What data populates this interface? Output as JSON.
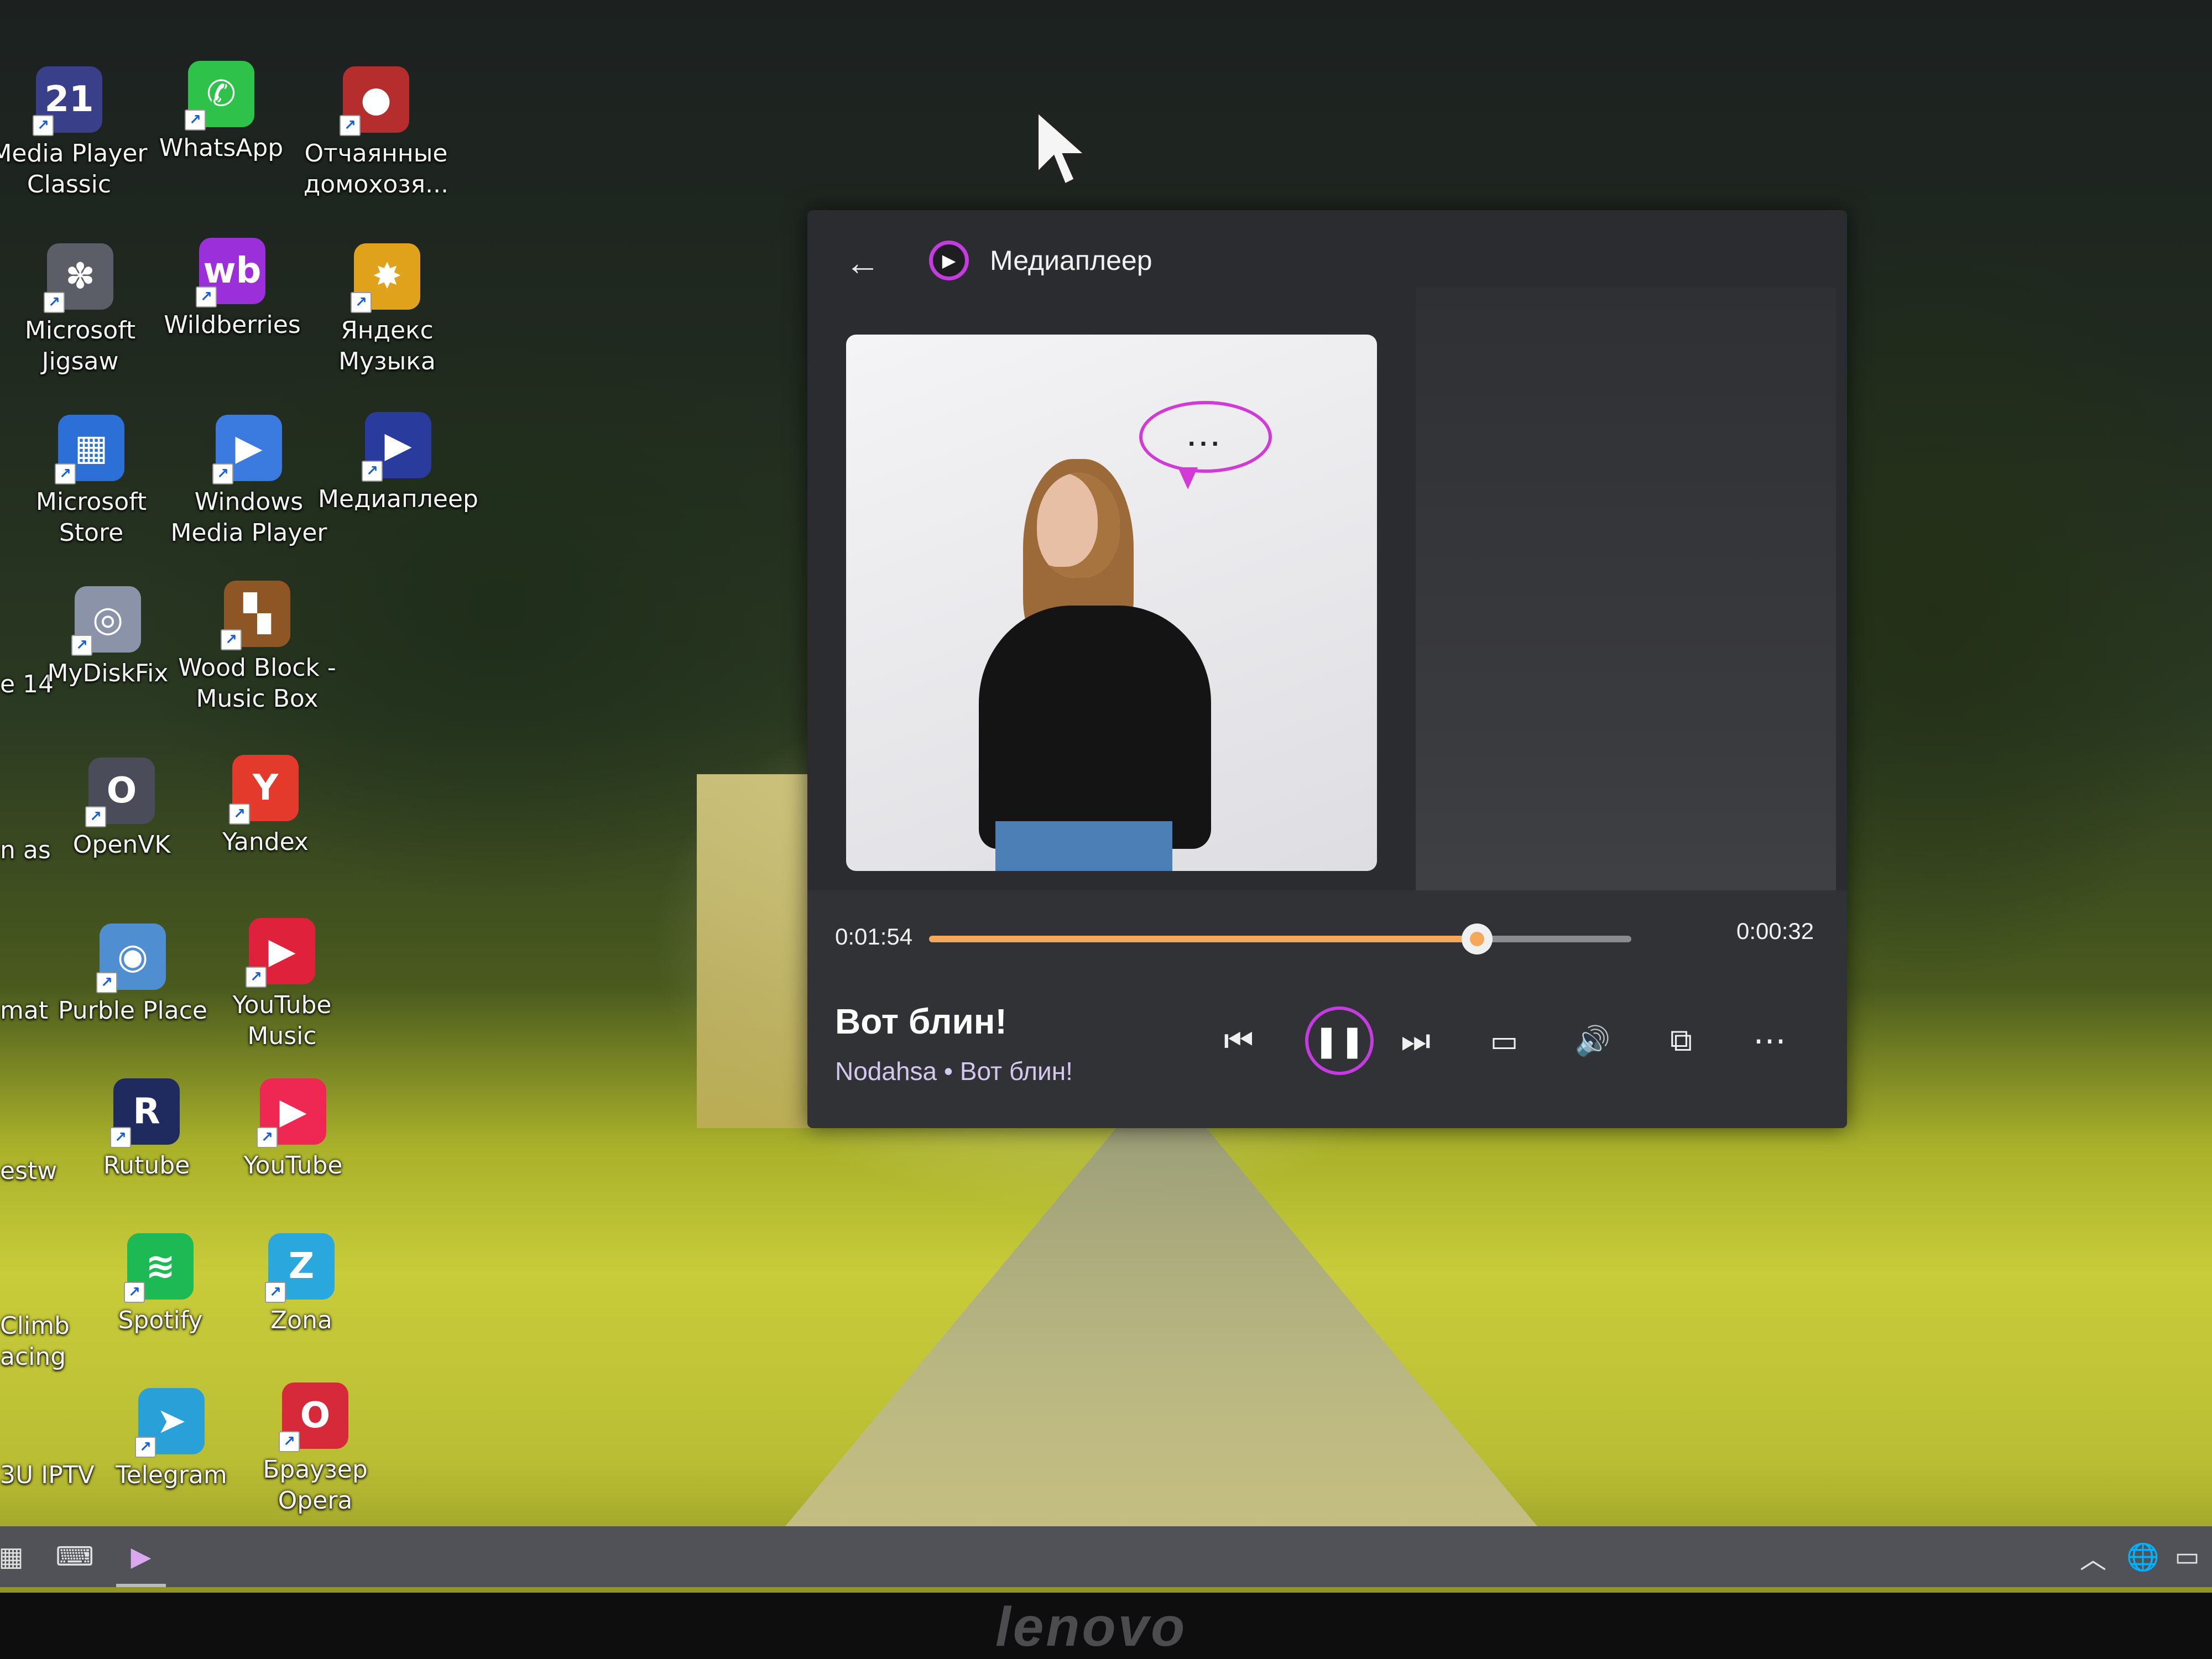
{
  "desktop": {
    "icons": [
      {
        "label": "Media Player Classic",
        "glyph": "21",
        "color": "#3a3f8a"
      },
      {
        "label": "WhatsApp",
        "glyph": "✆",
        "color": "#2ec24b"
      },
      {
        "label": "Отчаянные домохозя...",
        "glyph": "●",
        "color": "#b52d2d"
      },
      {
        "label": "Microsoft Jigsaw",
        "glyph": "✽",
        "color": "#5b5e66"
      },
      {
        "label": "Wildberries",
        "glyph": "wb",
        "color": "#9b2fd9"
      },
      {
        "label": "Яндекс Музыка",
        "glyph": "✸",
        "color": "#e0a21b"
      },
      {
        "label": "Microsoft Store",
        "glyph": "▦",
        "color": "#2c6fd6"
      },
      {
        "label": "Windows Media Player",
        "glyph": "▶",
        "color": "#3b7be0"
      },
      {
        "label": "Медиаплеер",
        "glyph": "▶",
        "color": "#2a3b9e"
      },
      {
        "label": "MyDiskFix",
        "glyph": "◎",
        "color": "#8a93a8"
      },
      {
        "label": "Wood Block - Music Box",
        "glyph": "▚",
        "color": "#8d5624"
      },
      {
        "label": "OpenVK",
        "glyph": "O",
        "color": "#4a4d59"
      },
      {
        "label": "Yandex",
        "glyph": "Y",
        "color": "#e33a2b"
      },
      {
        "label": "Purble Place",
        "glyph": "◉",
        "color": "#4f8fd1"
      },
      {
        "label": "YouTube Music",
        "glyph": "▶",
        "color": "#e0213c"
      },
      {
        "label": "Rutube",
        "glyph": "R",
        "color": "#1f2b5e"
      },
      {
        "label": "YouTube",
        "glyph": "▶",
        "color": "#ee2753"
      },
      {
        "label": "Spotify",
        "glyph": "≋",
        "color": "#1db954"
      },
      {
        "label": "Zona",
        "glyph": "Z",
        "color": "#2aa8dd"
      },
      {
        "label": "Telegram",
        "glyph": "➤",
        "color": "#2aa0d9"
      },
      {
        "label": "Браузер Opera",
        "glyph": "O",
        "color": "#d62a3b"
      }
    ],
    "partial_labels": [
      "e 14",
      "n as",
      "mat",
      "estw",
      "Climb acing",
      "3U IPTV"
    ]
  },
  "player": {
    "app_name": "Медиаплеер",
    "back_icon": "←",
    "time_elapsed": "0:01:54",
    "time_remaining": "0:00:32",
    "progress": 0.78,
    "song_title": "Вот блин!",
    "song_subtitle": "Nodahsa • Вот блин!",
    "bubble_text": "...",
    "accent_color": "#c43be0",
    "progress_color": "#f3a85a",
    "controls": {
      "previous": "⏮",
      "pause": "❚❚",
      "next": "⏭",
      "captions": "▭",
      "volume": "🔊",
      "miniplayer": "⧉",
      "more": "⋯"
    }
  },
  "taskbar": {
    "start": "▦",
    "keyboard": "⌨",
    "media": "▶",
    "chevron": "︿",
    "globe": "🌐",
    "battery": "▭"
  },
  "monitor": {
    "brand": "lenovo"
  }
}
